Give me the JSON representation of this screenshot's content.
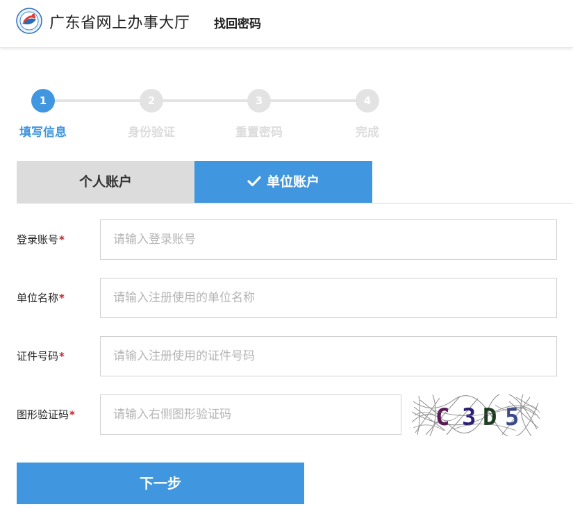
{
  "header": {
    "site_name": "广东省网上办事大厅",
    "page_title": "找回密码"
  },
  "steps": [
    {
      "number": "1",
      "label": "填写信息",
      "active": true
    },
    {
      "number": "2",
      "label": "身份验证",
      "active": false
    },
    {
      "number": "3",
      "label": "重置密码",
      "active": false
    },
    {
      "number": "4",
      "label": "完成",
      "active": false
    }
  ],
  "tabs": {
    "personal": "个人账户",
    "organization": "单位账户",
    "selected": "organization"
  },
  "form": {
    "account": {
      "label": "登录账号",
      "required_mark": "*",
      "placeholder": "请输入登录账号",
      "value": ""
    },
    "org_name": {
      "label": "单位名称",
      "required_mark": "*",
      "placeholder": "请输入注册使用的单位名称",
      "value": ""
    },
    "cert_no": {
      "label": "证件号码",
      "required_mark": "*",
      "placeholder": "请输入注册使用的证件号码",
      "value": ""
    },
    "captcha": {
      "label": "图形验证码",
      "required_mark": "*",
      "placeholder": "请输入右侧图形验证码",
      "value": "",
      "image_text": "C3D5"
    }
  },
  "next_button": "下一步",
  "colors": {
    "primary": "#4197df",
    "inactive_step": "#e3e3e3",
    "tab_inactive": "#dcdcdc",
    "required": "#c0252b"
  }
}
